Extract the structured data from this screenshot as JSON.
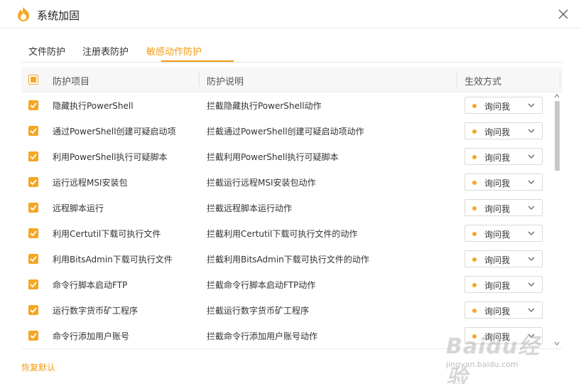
{
  "window": {
    "title": "系统加固",
    "icon": "flame-shield-icon",
    "close_icon": "close-icon"
  },
  "tabs": [
    {
      "label": "文件防护",
      "active": false
    },
    {
      "label": "注册表防护",
      "active": false
    },
    {
      "label": "敏感动作防护",
      "active": true
    }
  ],
  "table": {
    "headers": {
      "item": "防护项目",
      "description": "防护说明",
      "mode": "生效方式"
    },
    "select_all_state": "partial",
    "rows": [
      {
        "checked": true,
        "name": "隐藏执行PowerShell",
        "description": "拦截隐藏执行PowerShell动作",
        "mode": "询问我"
      },
      {
        "checked": true,
        "name": "通过PowerShell创建可疑启动项",
        "description": "拦截通过PowerShell创建可疑启动项动作",
        "mode": "询问我"
      },
      {
        "checked": true,
        "name": "利用PowerShell执行可疑脚本",
        "description": "拦截利用PowerShell执行可疑脚本",
        "mode": "询问我"
      },
      {
        "checked": true,
        "name": "运行远程MSI安装包",
        "description": "拦截运行远程MSI安装包动作",
        "mode": "询问我"
      },
      {
        "checked": true,
        "name": "远程脚本运行",
        "description": "拦截远程脚本运行动作",
        "mode": "询问我"
      },
      {
        "checked": true,
        "name": "利用Certutil下载可执行文件",
        "description": "拦截利用Certutil下载可执行文件的动作",
        "mode": "询问我"
      },
      {
        "checked": true,
        "name": "利用BitsAdmin下载可执行文件",
        "description": "拦截利用BitsAdmin下载可执行文件的动作",
        "mode": "询问我"
      },
      {
        "checked": true,
        "name": "命令行脚本启动FTP",
        "description": "拦截命令行脚本启动FTP动作",
        "mode": "询问我"
      },
      {
        "checked": true,
        "name": "运行数字货币矿工程序",
        "description": "拦截运行数字货币矿工程序",
        "mode": "询问我"
      },
      {
        "checked": true,
        "name": "命令行添加用户账号",
        "description": "拦截命令行添加用户账号动作",
        "mode": "询问我"
      }
    ]
  },
  "footer": {
    "restore_label": "恢复默认"
  },
  "watermark": {
    "brand": "Baidu经验",
    "url": "jingyan.baidu.com"
  },
  "colors": {
    "accent": "#f39c12",
    "checkbox": "#f5a623"
  }
}
